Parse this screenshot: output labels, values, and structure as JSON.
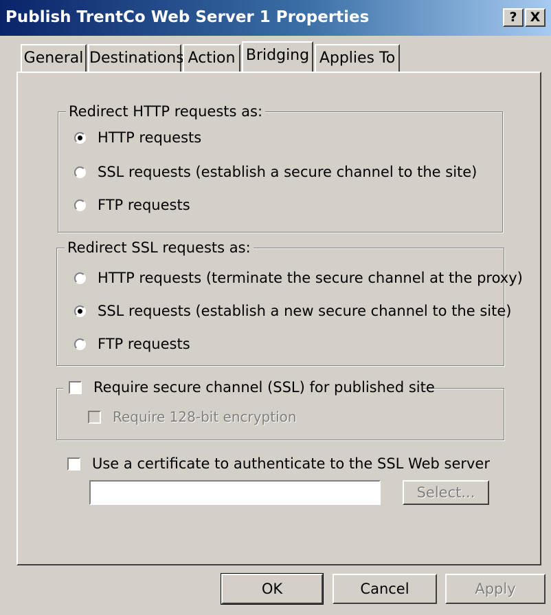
{
  "window": {
    "title": "Publish TrentCo Web Server 1 Properties",
    "help_label": "?",
    "close_label": "X"
  },
  "tabs": [
    {
      "label": "General",
      "selected": false
    },
    {
      "label": "Destinations",
      "selected": false
    },
    {
      "label": "Action",
      "selected": false
    },
    {
      "label": "Bridging",
      "selected": true
    },
    {
      "label": "Applies To",
      "selected": false
    }
  ],
  "http_group": {
    "legend": "Redirect HTTP requests as:",
    "options": [
      {
        "label": "HTTP requests",
        "checked": true
      },
      {
        "label": "SSL requests (establish a secure channel to the site)",
        "checked": false
      },
      {
        "label": "FTP requests",
        "checked": false
      }
    ]
  },
  "ssl_group": {
    "legend": "Redirect SSL requests as:",
    "options": [
      {
        "label": "HTTP requests (terminate the secure channel at the proxy)",
        "checked": false
      },
      {
        "label": "SSL requests (establish a new secure channel to the site)",
        "checked": true
      },
      {
        "label": "FTP requests",
        "checked": false
      }
    ]
  },
  "secure_channel": {
    "label": "Require secure channel (SSL) for published site",
    "checked": false,
    "sub_option": {
      "label": "Require 128-bit encryption",
      "checked": false,
      "enabled": false
    }
  },
  "certificate": {
    "label": "Use a certificate to authenticate to the SSL Web server",
    "checked": false,
    "field_value": "",
    "select_label": "Select..."
  },
  "buttons": {
    "ok": "OK",
    "cancel": "Cancel",
    "apply": "Apply"
  }
}
